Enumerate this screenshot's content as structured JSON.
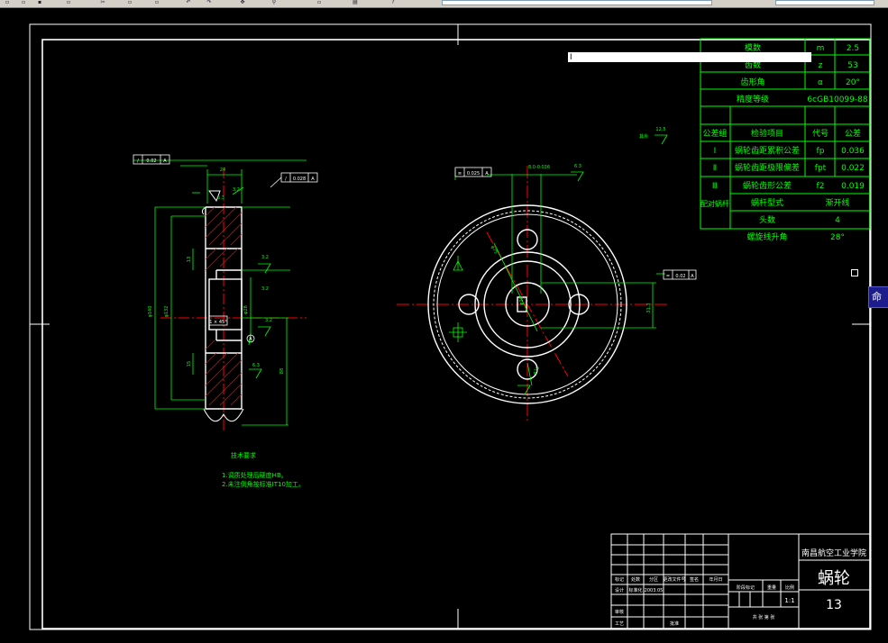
{
  "app": {
    "toolbar_icons": [
      "new-icon",
      "open-icon",
      "save-icon",
      "print-icon",
      "cut-icon",
      "copy-icon",
      "paste-icon",
      "undo-icon",
      "redo-icon",
      "pan-icon",
      "zoom-icon",
      "properties-icon",
      "layer-icon",
      "help-icon"
    ],
    "command_input_text": "I",
    "command_tab_label": "命令"
  },
  "params_table": {
    "rows": [
      {
        "label": "模数",
        "symbol": "m",
        "value": "2.5"
      },
      {
        "label": "齿数",
        "symbol": "z",
        "value": "53"
      },
      {
        "label": "齿形角",
        "symbol": "α",
        "value": "20°"
      },
      {
        "label": "精度等级",
        "value": "6cGB10099-88"
      }
    ],
    "header": {
      "group": "公差组",
      "item": "检验项目",
      "code": "代号",
      "tolerance": "公差"
    },
    "tol_rows": [
      {
        "group": "Ⅰ",
        "item": "蜗轮齿距累积公差",
        "code": "fp",
        "value": "0.036"
      },
      {
        "group": "Ⅱ",
        "item": "蜗轮齿距极限偏差",
        "code": "fpt",
        "value": "0.022"
      },
      {
        "group": "Ⅲ",
        "item": "蜗轮齿形公差",
        "code": "f2",
        "value": "0.019"
      }
    ],
    "mate": {
      "group": "配对蜗杆",
      "rows": [
        {
          "item": "蜗杆型式",
          "value": "渐开线"
        },
        {
          "item": "头数",
          "value": "4"
        },
        {
          "item": "螺旋线升角",
          "value": "28°"
        }
      ]
    }
  },
  "title_block": {
    "school": "南昌航空工业学院",
    "part_name": "蜗轮",
    "drawing_no": "13",
    "scale": "1:1",
    "date": "2003.05",
    "labels": {
      "mark": "标记",
      "count": "处数",
      "zone": "分区",
      "change_no": "更改文件号",
      "signature": "签名",
      "ymd": "年月日",
      "design": "设计",
      "standard": "标准化",
      "review": "审核",
      "process": "工艺",
      "approve": "批准",
      "stage": "阶段标记",
      "weight": "重量",
      "ratio": "比例",
      "sheets": "共 张 第 张"
    }
  },
  "notes": {
    "title": "技术要求",
    "items": [
      "1.调质处理后硬度HB。",
      "2.未注倒角按标准IT10加工。"
    ]
  },
  "dims": {
    "width": "24",
    "rough_a": "6.3",
    "rough_b": "3.2",
    "rough_c": "3.2",
    "rough_d": "3.2",
    "rough_e": "6.3",
    "rough_other": "12.5",
    "other_note": "其余",
    "keyway": "1 × 45°",
    "tol_runout": "0.02",
    "tol_pos": "0.028",
    "tol_sym": "0.025",
    "tol_par": "0.02",
    "datum": "A",
    "dia_outer": "φ140",
    "dia_inner": "φ132",
    "dia_hub": "φ28",
    "dia_pcd": "φ75",
    "keyslot": "31.3",
    "hole_dia": "φ10",
    "slot_width": "8.0-0.036",
    "dim_13": "13",
    "dim_15": "15",
    "dim_88": "88"
  },
  "colors": {
    "frame": "#ffffff",
    "geometry": "#ffffff",
    "dimension": "#00ff00",
    "centerline": "#ff0000",
    "hatch": "#ff0000",
    "table_text": "#00ff00",
    "table_line": "#00ff00",
    "command_tab": "#1c1c8c"
  }
}
